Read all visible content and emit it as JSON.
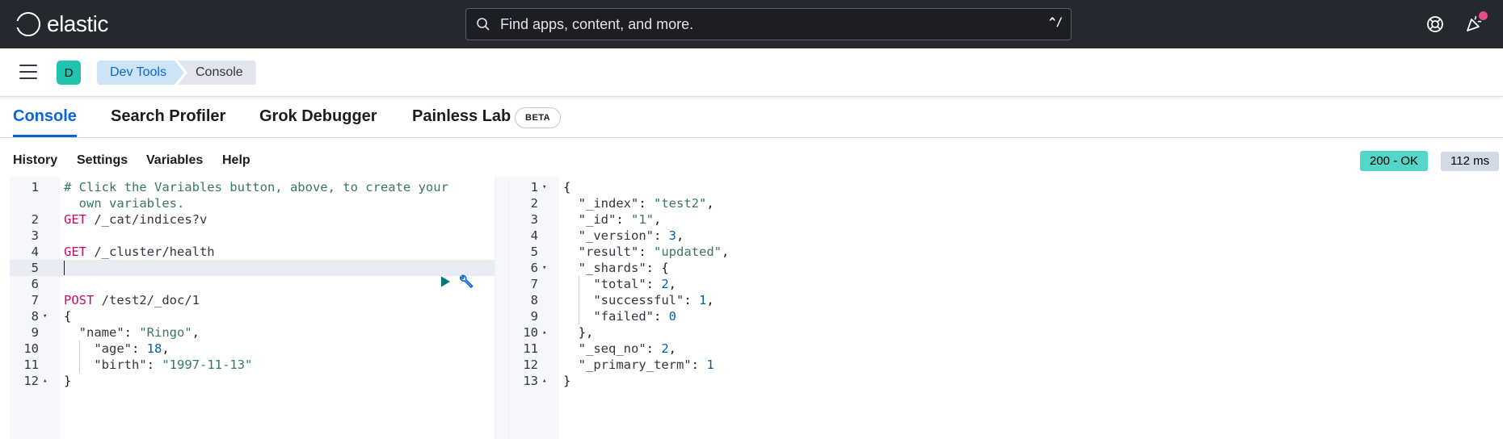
{
  "header": {
    "brand": "elastic",
    "search_placeholder": "Find apps, content, and more.",
    "search_shortcut": "^/"
  },
  "subbar": {
    "avatar_initial": "D",
    "breadcrumbs": [
      "Dev Tools",
      "Console"
    ]
  },
  "tabs": [
    {
      "label": "Console",
      "active": true
    },
    {
      "label": "Search Profiler"
    },
    {
      "label": "Grok Debugger"
    },
    {
      "label": "Painless Lab"
    }
  ],
  "beta_badge": "BETA",
  "toolbar": {
    "items": [
      "History",
      "Settings",
      "Variables",
      "Help"
    ],
    "status": "200 - OK",
    "time": "112 ms"
  },
  "request_editor": {
    "lines": [
      {
        "n": "1",
        "tokens": [
          {
            "t": "# Click the Variables button, above, to create your",
            "c": "c-comment"
          }
        ]
      },
      {
        "n": "",
        "tokens": [
          {
            "t": "  own variables.",
            "c": "c-comment"
          }
        ]
      },
      {
        "n": "2",
        "tokens": [
          {
            "t": "GET",
            "c": "c-method"
          },
          {
            "t": " /_cat/indices?v",
            "c": "c-url"
          }
        ]
      },
      {
        "n": "3",
        "tokens": []
      },
      {
        "n": "4",
        "tokens": [
          {
            "t": "GET",
            "c": "c-method"
          },
          {
            "t": " /_cluster/health",
            "c": "c-url"
          }
        ]
      },
      {
        "n": "5",
        "tokens": []
      },
      {
        "n": "6",
        "tokens": []
      },
      {
        "n": "7",
        "tokens": [
          {
            "t": "POST",
            "c": "c-method"
          },
          {
            "t": " /test2/_doc/1",
            "c": "c-url"
          }
        ]
      },
      {
        "n": "8",
        "fold": "down",
        "tokens": [
          {
            "t": "{",
            "c": ""
          }
        ]
      },
      {
        "n": "9",
        "tokens": [
          {
            "t": "  \"name\"",
            "c": "c-key"
          },
          {
            "t": ": ",
            "c": ""
          },
          {
            "t": "\"Ringo\"",
            "c": "c-str"
          },
          {
            "t": ",",
            "c": ""
          }
        ]
      },
      {
        "n": "10",
        "tokens": [
          {
            "t": "    \"age\"",
            "c": "c-key"
          },
          {
            "t": ": ",
            "c": ""
          },
          {
            "t": "18",
            "c": "c-num"
          },
          {
            "t": ",",
            "c": ""
          }
        ]
      },
      {
        "n": "11",
        "tokens": [
          {
            "t": "    \"birth\"",
            "c": "c-key"
          },
          {
            "t": ": ",
            "c": ""
          },
          {
            "t": "\"1997-11-13\"",
            "c": "c-str"
          }
        ]
      },
      {
        "n": "12",
        "fold": "up",
        "tokens": [
          {
            "t": "}",
            "c": ""
          }
        ]
      }
    ]
  },
  "response_editor": {
    "lines": [
      {
        "n": "1",
        "fold": "down",
        "tokens": [
          {
            "t": "{",
            "c": ""
          }
        ]
      },
      {
        "n": "2",
        "tokens": [
          {
            "t": "  \"_index\"",
            "c": "c-key"
          },
          {
            "t": ": ",
            "c": ""
          },
          {
            "t": "\"test2\"",
            "c": "c-str"
          },
          {
            "t": ",",
            "c": ""
          }
        ]
      },
      {
        "n": "3",
        "tokens": [
          {
            "t": "  \"_id\"",
            "c": "c-key"
          },
          {
            "t": ": ",
            "c": ""
          },
          {
            "t": "\"1\"",
            "c": "c-str"
          },
          {
            "t": ",",
            "c": ""
          }
        ]
      },
      {
        "n": "4",
        "tokens": [
          {
            "t": "  \"_version\"",
            "c": "c-key"
          },
          {
            "t": ": ",
            "c": ""
          },
          {
            "t": "3",
            "c": "c-num"
          },
          {
            "t": ",",
            "c": ""
          }
        ]
      },
      {
        "n": "5",
        "tokens": [
          {
            "t": "  \"result\"",
            "c": "c-key"
          },
          {
            "t": ": ",
            "c": ""
          },
          {
            "t": "\"updated\"",
            "c": "c-str"
          },
          {
            "t": ",",
            "c": ""
          }
        ]
      },
      {
        "n": "6",
        "fold": "down",
        "tokens": [
          {
            "t": "  \"_shards\"",
            "c": "c-key"
          },
          {
            "t": ": {",
            "c": ""
          }
        ]
      },
      {
        "n": "7",
        "tokens": [
          {
            "t": "    \"total\"",
            "c": "c-key"
          },
          {
            "t": ": ",
            "c": ""
          },
          {
            "t": "2",
            "c": "c-num"
          },
          {
            "t": ",",
            "c": ""
          }
        ]
      },
      {
        "n": "8",
        "tokens": [
          {
            "t": "    \"successful\"",
            "c": "c-key"
          },
          {
            "t": ": ",
            "c": ""
          },
          {
            "t": "1",
            "c": "c-num"
          },
          {
            "t": ",",
            "c": ""
          }
        ]
      },
      {
        "n": "9",
        "tokens": [
          {
            "t": "    \"failed\"",
            "c": "c-key"
          },
          {
            "t": ": ",
            "c": ""
          },
          {
            "t": "0",
            "c": "c-num"
          }
        ]
      },
      {
        "n": "10",
        "fold": "up",
        "tokens": [
          {
            "t": "  },",
            "c": ""
          }
        ]
      },
      {
        "n": "11",
        "tokens": [
          {
            "t": "  \"_seq_no\"",
            "c": "c-key"
          },
          {
            "t": ": ",
            "c": ""
          },
          {
            "t": "2",
            "c": "c-num"
          },
          {
            "t": ",",
            "c": ""
          }
        ]
      },
      {
        "n": "12",
        "tokens": [
          {
            "t": "  \"_primary_term\"",
            "c": "c-key"
          },
          {
            "t": ": ",
            "c": ""
          },
          {
            "t": "1",
            "c": "c-num"
          }
        ]
      },
      {
        "n": "13",
        "fold": "up",
        "tokens": [
          {
            "t": "}",
            "c": ""
          }
        ]
      }
    ]
  },
  "colors": {
    "header_bg": "#25282f",
    "accent": "#0b64dd",
    "status_ok": "#54d6c8",
    "avatar": "#20c3b0"
  },
  "icons": [
    "search-icon",
    "help-icon",
    "newsfeed-icon",
    "menu-icon",
    "play-icon",
    "wrench-icon"
  ]
}
